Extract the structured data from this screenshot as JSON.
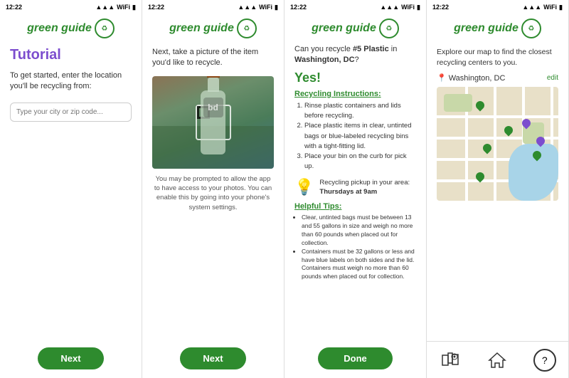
{
  "screens": [
    {
      "id": "screen1",
      "status_time": "12:22",
      "app_name": "green guide",
      "logo_text": "recycling\nguide",
      "title": "Tutorial",
      "description": "To get started, enter the location you'll be recycling from:",
      "input_placeholder": "Type your city or zip code...",
      "button_label": "Next"
    },
    {
      "id": "screen2",
      "status_time": "12:22",
      "app_name": "green guide",
      "logo_text": "recycling\nguide",
      "camera_text": "Next, take a picture of the item you'd like to recycle.",
      "permission_text": "You may be prompted to allow the app to have access to your photos. You can enable this by going into your phone's system settings.",
      "button_label": "Next"
    },
    {
      "id": "screen3",
      "status_time": "12:22",
      "app_name": "green guide",
      "logo_text": "recycling\nguide",
      "question": "Can you recycle #5 Plastic in Washington, DC?",
      "question_bold": "#5 Plastic",
      "yes_text": "Yes!",
      "instructions_title": "Recycling Instructions:",
      "instructions": [
        "Rinse plastic containers and lids before recycling.",
        "Place plastic items in clear, untinted bags or blue-labeled recycling bins with a tight-fitting lid.",
        "Place your bin on the curb for pick up."
      ],
      "pickup_label": "Recycling pickup in your area:",
      "pickup_time": "Thursdays at 9am",
      "helpful_title": "Helpful Tips:",
      "tips": [
        "Clear, untinted bags must be between 13 and 55 gallons in size and weigh no more than 60 pounds when placed out for collection.",
        "Containers must be 32 gallons or less and have blue labels on both sides and the lid. Containers must weigh no more than 60 pounds when placed out for collection."
      ],
      "done_button": "Done"
    },
    {
      "id": "screen4",
      "status_time": "12:22",
      "app_name": "green guide",
      "logo_text": "recycling\nguide",
      "map_desc": "Explore our map to find the closest recycling centers to you.",
      "location_name": "Washington, DC",
      "edit_label": "edit",
      "nav_items": [
        "map",
        "home",
        "help"
      ]
    }
  ]
}
